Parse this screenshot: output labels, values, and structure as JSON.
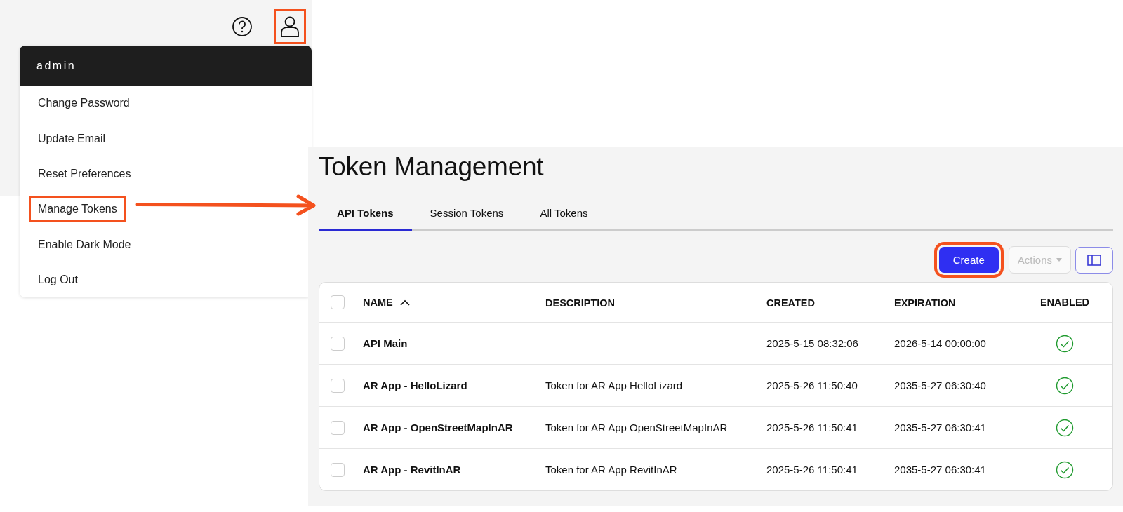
{
  "account_screen": {
    "help_button": {
      "highlighted": false
    },
    "profile_button": {
      "highlighted": true
    },
    "menu": {
      "user": "admin",
      "items": [
        {
          "label": "Change Password",
          "highlighted": false
        },
        {
          "label": "Update Email",
          "highlighted": false
        },
        {
          "label": "Reset Preferences",
          "highlighted": false
        },
        {
          "label": "Manage Tokens",
          "highlighted": true
        },
        {
          "label": "Enable Dark Mode",
          "highlighted": false
        },
        {
          "label": "Log Out",
          "highlighted": false
        }
      ]
    }
  },
  "token_screen": {
    "title": "Token Management",
    "tabs": [
      {
        "label": "API Tokens",
        "selected": true
      },
      {
        "label": "Session Tokens",
        "selected": false
      },
      {
        "label": "All Tokens",
        "selected": false
      }
    ],
    "toolbar": {
      "create": {
        "label": "Create",
        "disabled": false,
        "highlighted": true
      },
      "actions": {
        "label": "Actions",
        "disabled": true,
        "highlighted": false
      }
    },
    "table": {
      "select_all_checked": false,
      "columns": [
        {
          "label": "NAME",
          "sorted": true
        },
        {
          "label": "DESCRIPTION",
          "sorted": false
        },
        {
          "label": "CREATED",
          "sorted": false
        },
        {
          "label": "EXPIRATION",
          "sorted": false
        },
        {
          "label": "ENABLED",
          "sorted": false
        }
      ],
      "rows": [
        {
          "checked": false,
          "name": "API Main",
          "description": "",
          "created": "2025-5-15 08:32:06",
          "expiration": "2026-5-14 00:00:00",
          "enabled": true
        },
        {
          "checked": false,
          "name": "AR App - HelloLizard",
          "description": "Token for AR App HelloLizard",
          "created": "2025-5-26 11:50:40",
          "expiration": "2035-5-27 06:30:40",
          "enabled": true
        },
        {
          "checked": false,
          "name": "AR App - OpenStreetMapInAR",
          "description": "Token for AR App OpenStreetMapInAR",
          "created": "2025-5-26 11:50:41",
          "expiration": "2035-5-27 06:30:41",
          "enabled": true
        },
        {
          "checked": false,
          "name": "AR App - RevitInAR",
          "description": "Token for AR App RevitInAR",
          "created": "2025-5-26 11:50:41",
          "expiration": "2035-5-27 06:30:41",
          "enabled": true
        }
      ]
    }
  }
}
